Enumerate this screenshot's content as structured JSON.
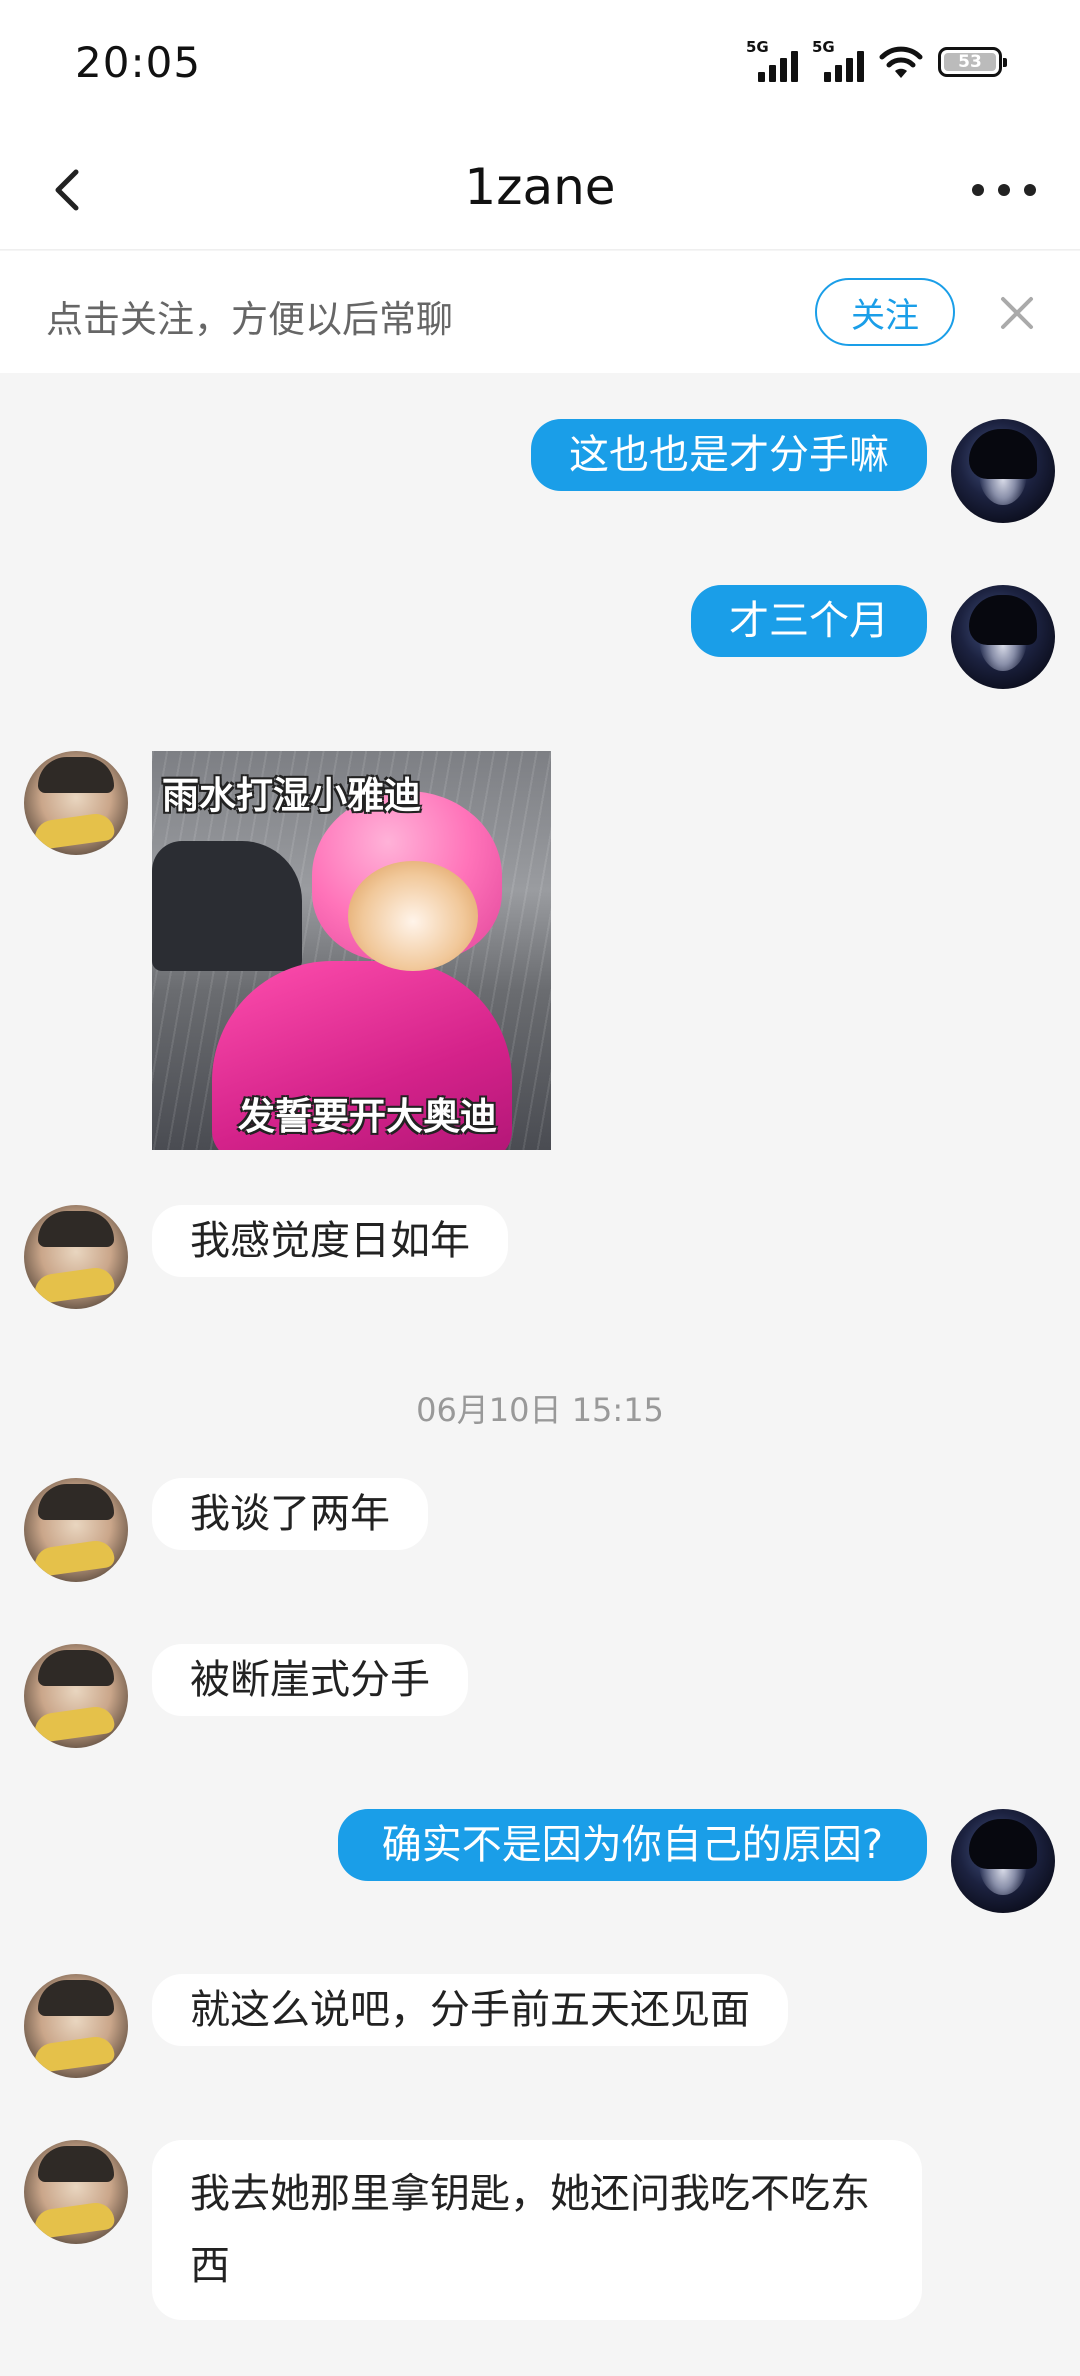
{
  "status_bar": {
    "time": "20:05",
    "network_tag_1": "5G",
    "network_tag_2": "5G",
    "battery_level": "53"
  },
  "header": {
    "title": "1zane",
    "back_icon": "chevron-left-icon",
    "more_icon": "more-dots-icon"
  },
  "follow_banner": {
    "text": "点击关注，方便以后常聊",
    "button_label": "关注",
    "close_icon": "close-icon"
  },
  "messages": [
    {
      "sender": "me",
      "type": "text",
      "text": "这也也是才分手嘛"
    },
    {
      "sender": "me",
      "type": "text",
      "text": "才三个月"
    },
    {
      "sender": "other",
      "type": "sticker",
      "caption_top": "雨水打湿小雅迪",
      "caption_bottom": "发誓要开大奥迪"
    },
    {
      "sender": "other",
      "type": "text",
      "text": "我感觉度日如年"
    },
    {
      "type": "timestamp",
      "text": "06月10日 15:15"
    },
    {
      "sender": "other",
      "type": "text",
      "text": "我谈了两年"
    },
    {
      "sender": "other",
      "type": "text",
      "text": "被断崖式分手"
    },
    {
      "sender": "me",
      "type": "text",
      "text": "确实不是因为你自己的原因?"
    },
    {
      "sender": "other",
      "type": "text",
      "text": "就这么说吧，分手前五天还见面"
    },
    {
      "sender": "other",
      "type": "text",
      "text": "我去她那里拿钥匙，她还问我吃不吃东西"
    }
  ],
  "colors": {
    "accent": "#1a9ee8",
    "background": "#f5f5f5",
    "bubble_other": "#ffffff",
    "bubble_me": "#1a9ee8"
  }
}
